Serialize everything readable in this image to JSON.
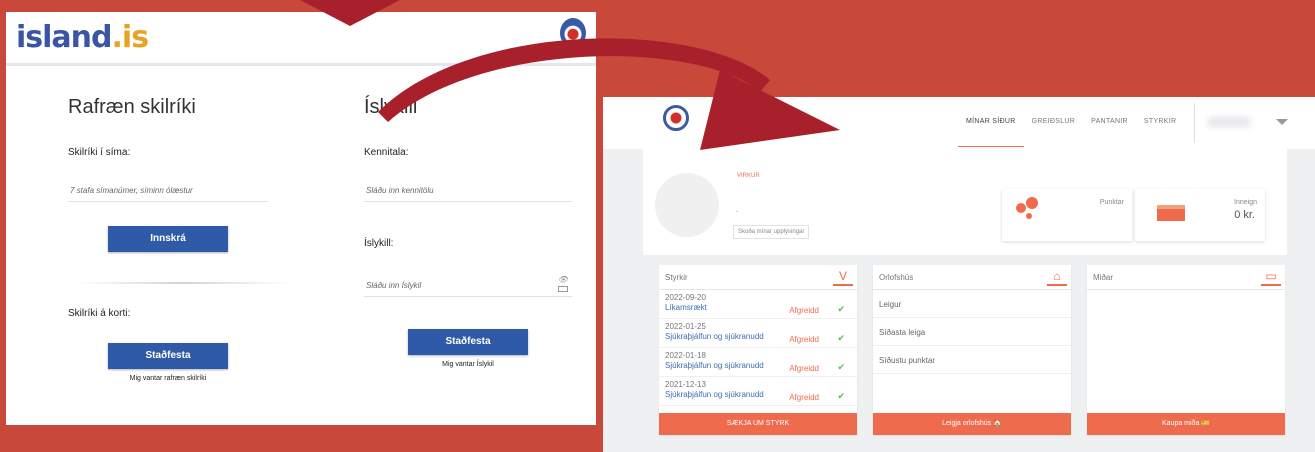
{
  "login": {
    "logo": {
      "main": "island",
      "suffix": "is"
    },
    "electronic": {
      "title": "Rafræn skilríki",
      "phone_label": "Skilríki í síma:",
      "phone_placeholder": "7 stafa símanúmer, síminn ólæstur",
      "login_button": "Innskrá",
      "card_label": "Skilríki á korti:",
      "confirm_button": "Staðfesta",
      "missing_link": "Mig vantar rafræn skilríki"
    },
    "islykill": {
      "title": "Íslykill",
      "kennitala_label": "Kennitala:",
      "kennitala_placeholder": "Sláðu inn kennitölu",
      "islykill_label": "Íslykill:",
      "islykill_placeholder": "Sláðu inn Íslykil",
      "confirm_button": "Staðfesta",
      "missing_link": "Mig vantar Íslykil"
    }
  },
  "site": {
    "nav": [
      "MÍNAR SÍÐUR",
      "GREIÐSLUR",
      "PANTANIR",
      "STYRKIR"
    ],
    "profile": {
      "status": "VIRKUR",
      "dash": "-",
      "edit_button": "Skoða mínar upplýsingar"
    },
    "stats": {
      "points_label": "Punktar",
      "balance_label": "Inneign",
      "balance_value": "0 kr."
    },
    "styrkir": {
      "title": "Styrkir",
      "icon": "V",
      "rows": [
        {
          "date": "2022-09-20",
          "type": "Líkamsrækt",
          "status": "Afgreidd"
        },
        {
          "date": "2022-01-25",
          "type": "Sjúkraþjálfun og sjúkranudd",
          "status": "Afgreidd"
        },
        {
          "date": "2022-01-18",
          "type": "Sjúkraþjálfun og sjúkranudd",
          "status": "Afgreidd"
        },
        {
          "date": "2021-12-13",
          "type": "Sjúkraþjálfun og sjúkranudd",
          "status": "Afgreidd"
        }
      ],
      "footer": "SÆKJA UM STYRK"
    },
    "orlofshus": {
      "title": "Orlofshús",
      "rows": [
        "Leigur",
        "Síðasta leiga",
        "Síðustu punktar"
      ],
      "footer": "Leigja orlofshús 🏠"
    },
    "midar": {
      "title": "Miðar",
      "footer": "Kaupa miða 🎫"
    }
  },
  "colors": {
    "accent": "#ee6c4d",
    "blue": "#2f5aa7",
    "background": "#c8483a"
  }
}
